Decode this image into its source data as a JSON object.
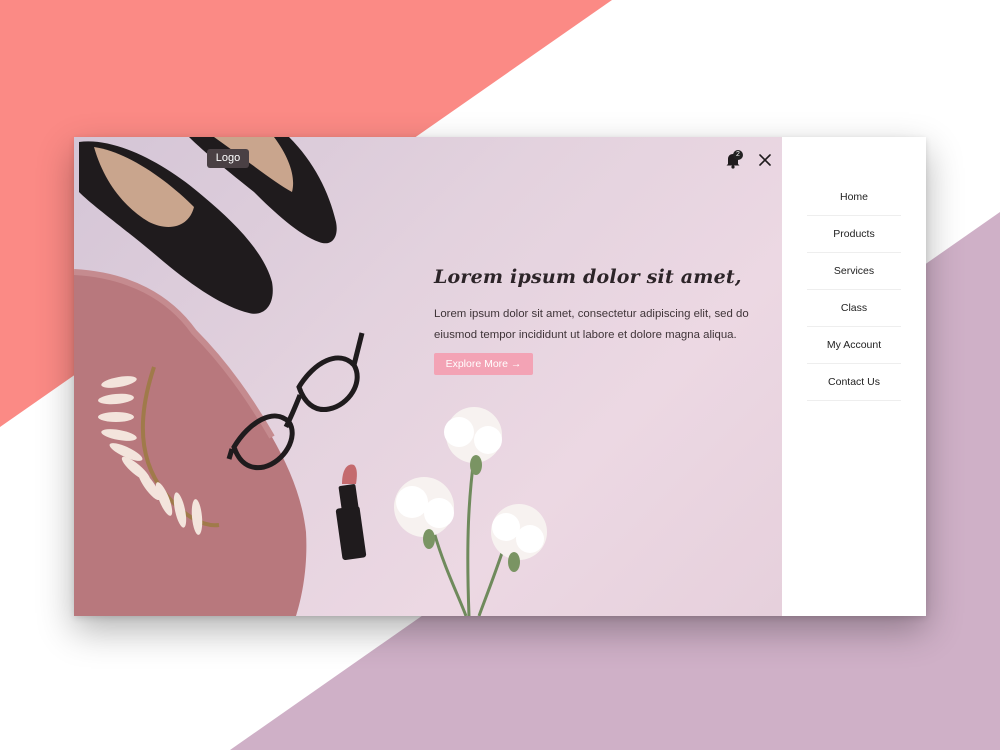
{
  "header": {
    "logo_label": "Logo",
    "notification_count": "2"
  },
  "hero": {
    "title": "Lorem ipsum dolor sit amet,",
    "body": "Lorem ipsum dolor sit amet, consectetur adipiscing elit, sed do eiusmod tempor incididunt ut labore et dolore magna aliqua.",
    "cta_label": "Explore More →"
  },
  "menu": {
    "items": [
      {
        "label": "Home"
      },
      {
        "label": "Products"
      },
      {
        "label": "Services"
      },
      {
        "label": "Class"
      },
      {
        "label": "My Account"
      },
      {
        "label": "Contact Us"
      }
    ]
  },
  "colors": {
    "coral": "#fb8a85",
    "mauve": "#cfb0c7",
    "cta": "#f3a3b5",
    "hero_bg": "#e6d3df"
  },
  "icons": [
    "bell-icon",
    "close-icon"
  ]
}
